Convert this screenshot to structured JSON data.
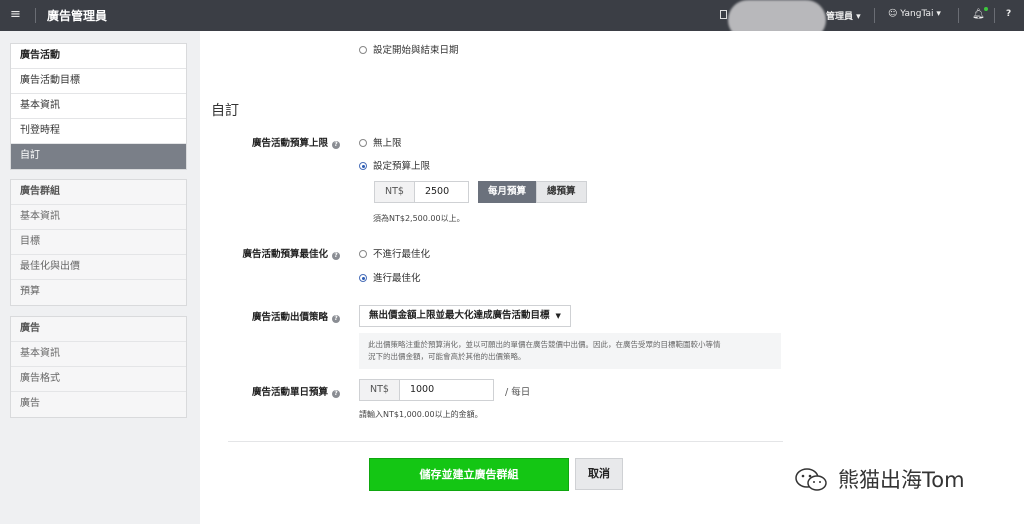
{
  "topbar": {
    "title": "廣告管理員",
    "role": "管理員",
    "user": "YangTai"
  },
  "sidebar": {
    "campaign": {
      "header": "廣告活動",
      "items": [
        "廣告活動目標",
        "基本資訊",
        "刊登時程",
        "自訂"
      ]
    },
    "adgroup": {
      "header": "廣告群組",
      "items": [
        "基本資訊",
        "目標",
        "最佳化與出價",
        "預算"
      ]
    },
    "ad": {
      "header": "廣告",
      "items": [
        "基本資訊",
        "廣告格式",
        "廣告"
      ]
    }
  },
  "main": {
    "date_option": "設定開始與結束日期",
    "section_title": "自訂",
    "budget_cap": {
      "label": "廣告活動預算上限",
      "opt_none": "無上限",
      "opt_set": "設定預算上限",
      "currency": "NT$",
      "value": "2500",
      "seg_monthly": "每月預算",
      "seg_total": "總預算",
      "hint": "須為NT$2,500.00以上。"
    },
    "optimization": {
      "label": "廣告活動預算最佳化",
      "opt_off": "不進行最佳化",
      "opt_on": "進行最佳化"
    },
    "bid_strategy": {
      "label": "廣告活動出價策略",
      "selected": "無出價金額上限並最大化達成廣告活動目標",
      "note_line1": "此出價策略注重於預算消化，並以可願出的單價在廣告競價中出價。因此，在廣告受眾的目標範圍較小等情",
      "note_line2": "況下的出價金額，可能會高於其他的出價策略。"
    },
    "daily_budget": {
      "label": "廣告活動單日預算",
      "currency": "NT$",
      "value": "1000",
      "suffix": "/ 每日",
      "hint": "請輸入NT$1,000.00以上的金額。"
    },
    "save_button": "儲存並建立廣告群組",
    "cancel_button": "取消"
  },
  "watermark": "熊猫出海Tom"
}
